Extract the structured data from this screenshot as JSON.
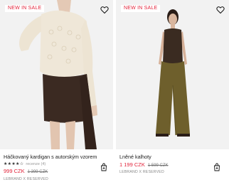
{
  "products": [
    {
      "badge": "NEW IN SALE",
      "title": "Háčkovaný kardigan s autorským vzorem",
      "rating_stars": "★★★★☆",
      "rating_count": "recenze (4)",
      "price_sale": "999 CZK",
      "price_old": "1 399 CZK",
      "brand": "LEBRAND X RESERVED"
    },
    {
      "badge": "NEW IN SALE",
      "title": "Lněné kalhoty",
      "price_sale": "1 199 CZK",
      "price_old": "1 599 CZK",
      "brand": "LEBRAND X RESERVED"
    }
  ],
  "colors": {
    "sale": "#e2233a",
    "photo_bg": "#f1f1f1"
  },
  "icons": [
    "heart-icon",
    "shopping-bag-icon"
  ]
}
